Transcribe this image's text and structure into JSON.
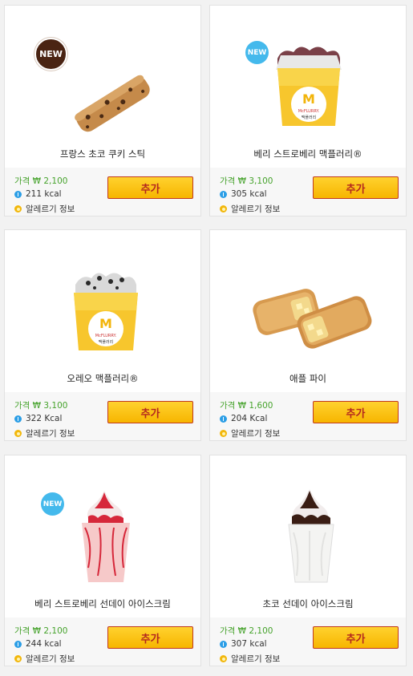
{
  "products": [
    {
      "badge": "NEW",
      "name": "프랑스 초코 쿠키 스틱",
      "price": "가격 ₩ 2,100",
      "kcal": "211 kcal",
      "allergy": "알레르기 정보",
      "add": "추가"
    },
    {
      "badge": "NEW",
      "name": "베리 스트로베리 맥플러리®",
      "price": "가격 ₩ 3,100",
      "kcal": "305 kcal",
      "allergy": "알레르기 정보",
      "add": "추가"
    },
    {
      "badge": "",
      "name": "오레오 맥플러리®",
      "price": "가격 ₩ 3,100",
      "kcal": "322 Kcal",
      "allergy": "알레르기 정보",
      "add": "추가"
    },
    {
      "badge": "",
      "name": "애플 파이",
      "price": "가격 ₩ 1,600",
      "kcal": "204 Kcal",
      "allergy": "알레르기 정보",
      "add": "추가"
    },
    {
      "badge": "NEW",
      "name": "베리 스트로베리 선데이 아이스크림",
      "price": "가격 ₩ 2,100",
      "kcal": "244 kcal",
      "allergy": "알레르기 정보",
      "add": "추가"
    },
    {
      "badge": "",
      "name": "초코 선데이 아이스크림",
      "price": "가격 ₩ 2,100",
      "kcal": "307 kcal",
      "allergy": "알레르기 정보",
      "add": "추가"
    }
  ],
  "mcflurry_cup_text": {
    "brand": "McFLURRY.",
    "korean": "맥플러리"
  },
  "colors": {
    "price": "#46a32c",
    "button": "#ffc20e",
    "button_text": "#b3261e",
    "new_dark": "#4a2413",
    "new_blue": "#44b9ec"
  }
}
